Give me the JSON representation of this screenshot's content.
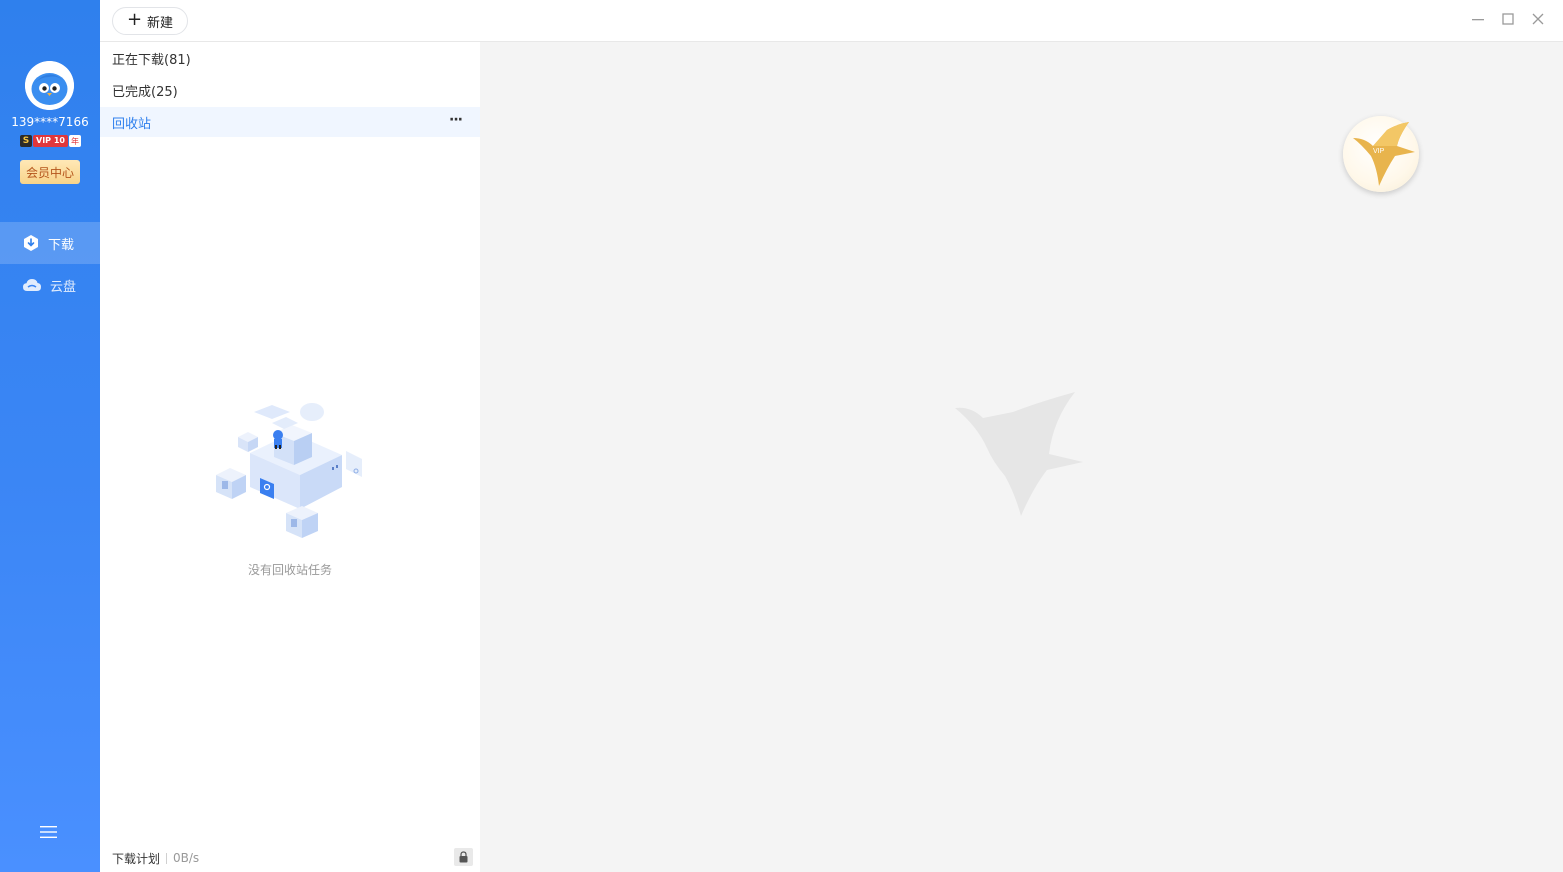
{
  "user": {
    "phone": "139****7166",
    "vip_s": "S",
    "vip_label": "VIP 10",
    "vip_year": "年",
    "member_center": "会员中心"
  },
  "nav": {
    "download": "下载",
    "cloud": "云盘"
  },
  "toolbar": {
    "new_label": "新建"
  },
  "list": {
    "items": [
      {
        "label": "正在下载(81)"
      },
      {
        "label": "已完成(25)"
      },
      {
        "label": "回收站"
      }
    ],
    "more": "···"
  },
  "empty": {
    "text": "没有回收站任务"
  },
  "footer": {
    "plan": "下载计划",
    "speed": "0B/s"
  },
  "vip_float": {
    "label": "VIP"
  },
  "colors": {
    "sidebar": "#2f80ed",
    "accent": "#2f80ed",
    "content_bg": "#f4f4f4"
  }
}
